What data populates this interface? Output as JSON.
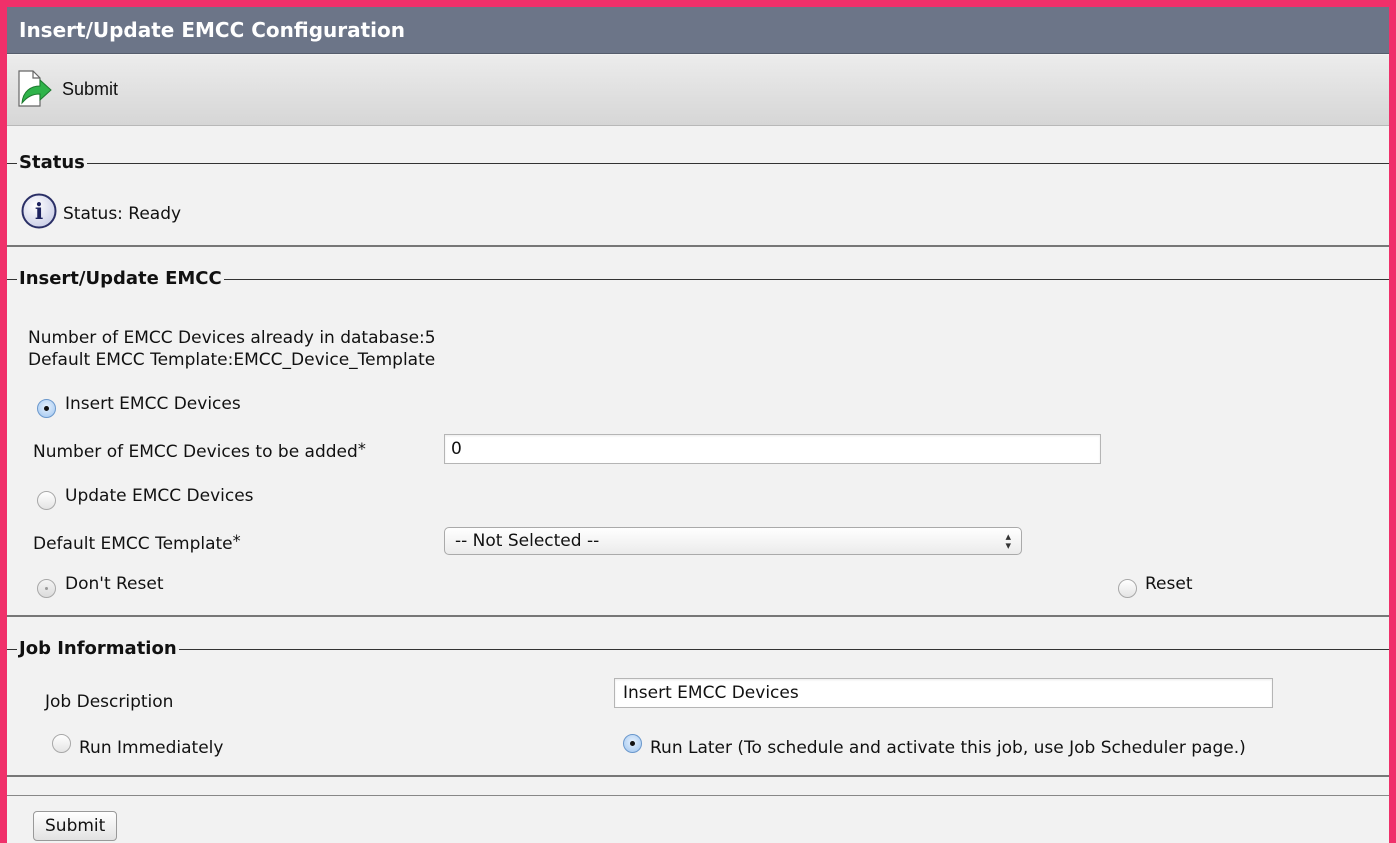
{
  "window": {
    "title": "Insert/Update EMCC Configuration"
  },
  "toolbar": {
    "submit_label": "Submit",
    "submit_icon": "submit-arrow-icon"
  },
  "status_section": {
    "legend": "Status",
    "icon": "info-icon",
    "text": "Status: Ready"
  },
  "emcc_section": {
    "legend": "Insert/Update EMCC",
    "existing_count_text": "Number of EMCC Devices already in database:5",
    "default_template_text": "Default EMCC Template:EMCC_Device_Template",
    "insert_radio_label": "Insert EMCC Devices",
    "insert_selected": true,
    "devices_to_add_label": "Number of EMCC Devices to be added",
    "devices_to_add_value": "0",
    "required_marker": "*",
    "update_radio_label": "Update EMCC Devices",
    "update_selected": false,
    "template_label": "Default EMCC Template",
    "template_selected": "-- Not Selected --",
    "dont_reset_label": "Don't Reset",
    "reset_label": "Reset"
  },
  "job_section": {
    "legend": "Job Information",
    "description_label": "Job Description",
    "description_value": "Insert EMCC Devices",
    "run_immediately_label": "Run Immediately",
    "run_later_label": "Run Later (To schedule and activate this job, use Job Scheduler page.)",
    "run_later_selected": true
  },
  "footer": {
    "submit_label": "Submit"
  },
  "colors": {
    "frame": "#f0306a",
    "titlebar": "#6c7588",
    "background": "#f2f2f2"
  }
}
